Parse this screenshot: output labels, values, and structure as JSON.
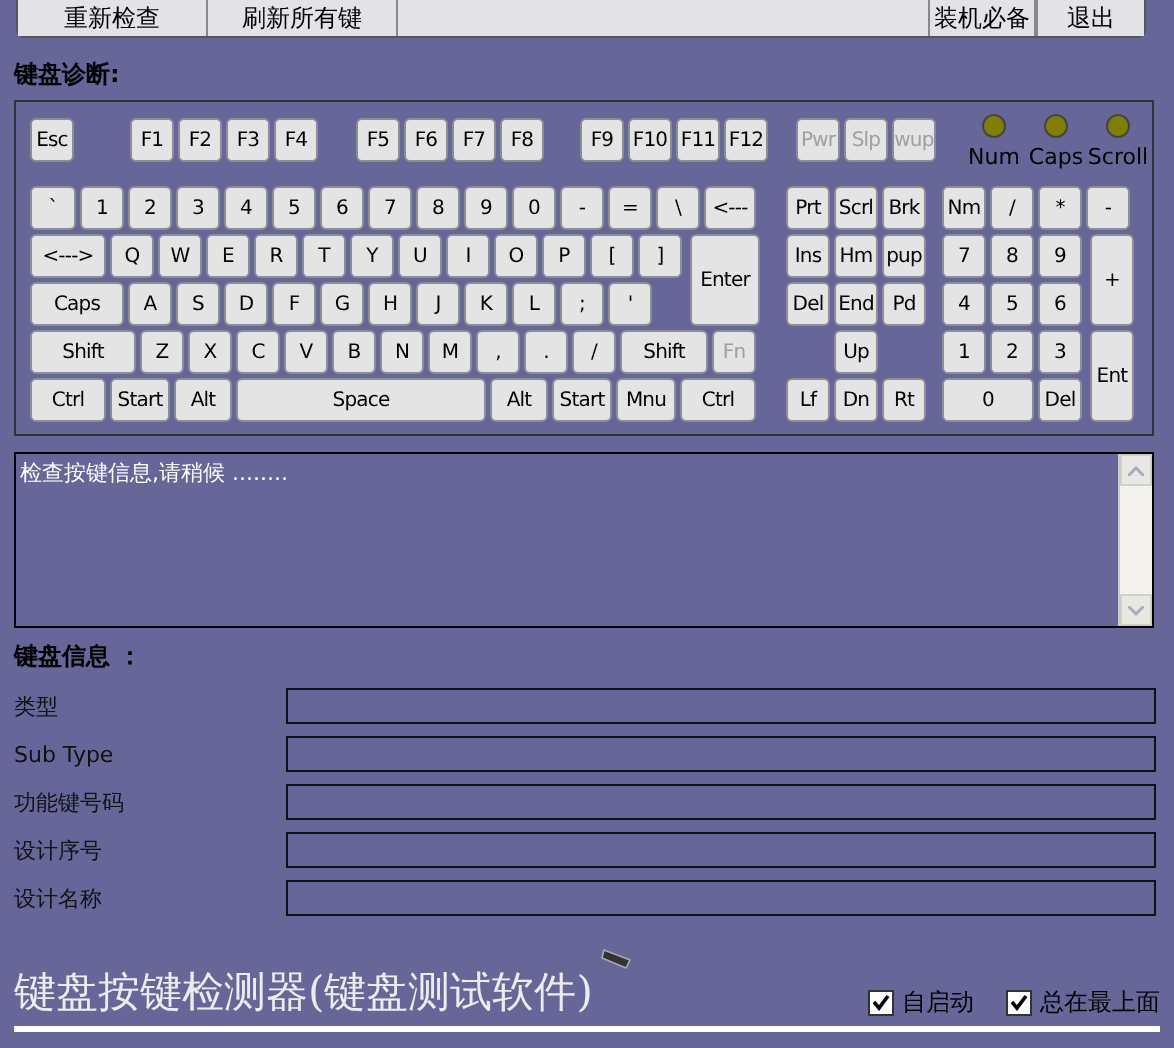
{
  "toolbar": {
    "buttons": [
      "重新检查",
      "刷新所有键",
      "装机必备",
      "退出"
    ]
  },
  "keyboard_section": {
    "title": "键盘诊断:",
    "function_row": [
      [
        {
          "label": "Esc",
          "disabled": false
        }
      ],
      [
        {
          "label": "F1",
          "disabled": false
        },
        {
          "label": "F2",
          "disabled": false
        },
        {
          "label": "F3",
          "disabled": false
        },
        {
          "label": "F4",
          "disabled": false
        }
      ],
      [
        {
          "label": "F5",
          "disabled": false
        },
        {
          "label": "F6",
          "disabled": false
        },
        {
          "label": "F7",
          "disabled": false
        },
        {
          "label": "F8",
          "disabled": false
        }
      ],
      [
        {
          "label": "F9",
          "disabled": false
        },
        {
          "label": "F10",
          "disabled": false
        },
        {
          "label": "F11",
          "disabled": false
        },
        {
          "label": "F12",
          "disabled": false
        }
      ],
      [
        {
          "label": "Pwr",
          "disabled": true
        },
        {
          "label": "Slp",
          "disabled": true
        },
        {
          "label": "wup",
          "disabled": true
        }
      ]
    ],
    "indicators": [
      {
        "label": "Num",
        "on": false
      },
      {
        "label": "Caps",
        "on": false
      },
      {
        "label": "Scroll",
        "on": false
      }
    ],
    "main": [
      [
        {
          "label": "`",
          "disabled": false
        },
        {
          "label": "1",
          "disabled": false
        },
        {
          "label": "2",
          "disabled": false
        },
        {
          "label": "3",
          "disabled": false
        },
        {
          "label": "4",
          "disabled": false
        },
        {
          "label": "5",
          "disabled": false
        },
        {
          "label": "6",
          "disabled": false
        },
        {
          "label": "7",
          "disabled": false
        },
        {
          "label": "8",
          "disabled": false
        },
        {
          "label": "9",
          "disabled": false
        },
        {
          "label": "0",
          "disabled": false
        },
        {
          "label": "-",
          "disabled": false
        },
        {
          "label": "=",
          "disabled": false
        },
        {
          "label": "\\",
          "disabled": false
        },
        {
          "label": "<---",
          "disabled": false
        }
      ],
      [
        {
          "label": "<--->",
          "disabled": false
        },
        {
          "label": "Q",
          "disabled": false
        },
        {
          "label": "W",
          "disabled": false
        },
        {
          "label": "E",
          "disabled": false
        },
        {
          "label": "R",
          "disabled": false
        },
        {
          "label": "T",
          "disabled": false
        },
        {
          "label": "Y",
          "disabled": false
        },
        {
          "label": "U",
          "disabled": false
        },
        {
          "label": "I",
          "disabled": false
        },
        {
          "label": "O",
          "disabled": false
        },
        {
          "label": "P",
          "disabled": false
        },
        {
          "label": "[",
          "disabled": false
        },
        {
          "label": "]",
          "disabled": false
        },
        {
          "label": "Enter",
          "disabled": false,
          "kind": "tall"
        }
      ],
      [
        {
          "label": "Caps",
          "disabled": false
        },
        {
          "label": "A",
          "disabled": false
        },
        {
          "label": "S",
          "disabled": false
        },
        {
          "label": "D",
          "disabled": false
        },
        {
          "label": "F",
          "disabled": false
        },
        {
          "label": "G",
          "disabled": false
        },
        {
          "label": "H",
          "disabled": false
        },
        {
          "label": "J",
          "disabled": false
        },
        {
          "label": "K",
          "disabled": false
        },
        {
          "label": "L",
          "disabled": false
        },
        {
          "label": ";",
          "disabled": false
        },
        {
          "label": "'",
          "disabled": false
        }
      ],
      [
        {
          "label": "Shift",
          "disabled": false
        },
        {
          "label": "Z",
          "disabled": false
        },
        {
          "label": "X",
          "disabled": false
        },
        {
          "label": "C",
          "disabled": false
        },
        {
          "label": "V",
          "disabled": false
        },
        {
          "label": "B",
          "disabled": false
        },
        {
          "label": "N",
          "disabled": false
        },
        {
          "label": "M",
          "disabled": false
        },
        {
          "label": ",",
          "disabled": false
        },
        {
          "label": ".",
          "disabled": false
        },
        {
          "label": "/",
          "disabled": false
        },
        {
          "label": "Shift",
          "disabled": false
        },
        {
          "label": "Fn",
          "disabled": true
        }
      ],
      [
        {
          "label": "Ctrl",
          "disabled": false
        },
        {
          "label": "Start",
          "disabled": false
        },
        {
          "label": "Alt",
          "disabled": false
        },
        {
          "label": "Space",
          "disabled": false
        },
        {
          "label": "Alt",
          "disabled": false
        },
        {
          "label": "Start",
          "disabled": false
        },
        {
          "label": "Mnu",
          "disabled": false
        },
        {
          "label": "Ctrl",
          "disabled": false
        }
      ]
    ],
    "navigation": [
      [
        {
          "label": "Prt",
          "disabled": false
        },
        {
          "label": "Scrl",
          "disabled": false
        },
        {
          "label": "Brk",
          "disabled": false
        }
      ],
      [
        {
          "label": "Ins",
          "disabled": false
        },
        {
          "label": "Hm",
          "disabled": false
        },
        {
          "label": "pup",
          "disabled": false
        }
      ],
      [
        {
          "label": "Del",
          "disabled": false
        },
        {
          "label": "End",
          "disabled": false
        },
        {
          "label": "Pd",
          "disabled": false
        }
      ],
      [
        {
          "label": "Up",
          "disabled": false
        }
      ],
      [
        {
          "label": "Lf",
          "disabled": false
        },
        {
          "label": "Dn",
          "disabled": false
        },
        {
          "label": "Rt",
          "disabled": false
        }
      ]
    ],
    "numpad": [
      [
        {
          "label": "Nm",
          "disabled": false
        },
        {
          "label": "/",
          "disabled": false
        },
        {
          "label": "*",
          "disabled": false
        },
        {
          "label": "-",
          "disabled": false
        }
      ],
      [
        {
          "label": "7",
          "disabled": false
        },
        {
          "label": "8",
          "disabled": false
        },
        {
          "label": "9",
          "disabled": false
        },
        {
          "label": "+",
          "disabled": false,
          "kind": "tall"
        }
      ],
      [
        {
          "label": "4",
          "disabled": false
        },
        {
          "label": "5",
          "disabled": false
        },
        {
          "label": "6",
          "disabled": false
        }
      ],
      [
        {
          "label": "1",
          "disabled": false
        },
        {
          "label": "2",
          "disabled": false
        },
        {
          "label": "3",
          "disabled": false
        },
        {
          "label": "Ent",
          "disabled": false,
          "kind": "tall"
        }
      ],
      [
        {
          "label": "0",
          "disabled": false
        },
        {
          "label": "Del",
          "disabled": false
        }
      ]
    ]
  },
  "log": {
    "text": "检查按键信息,请稍候 ........"
  },
  "info_section": {
    "title": "键盘信息 ：",
    "fields": [
      {
        "label": "类型"
      },
      {
        "label": "Sub Type"
      },
      {
        "label": "功能键号码"
      },
      {
        "label": "设计序号"
      },
      {
        "label": "设计名称"
      }
    ]
  },
  "footer": {
    "title": "键盘按键检测器(键盘测试软件)",
    "options": [
      {
        "label": "自启动",
        "checked": true
      },
      {
        "label": "总在最上面",
        "checked": true
      }
    ]
  }
}
